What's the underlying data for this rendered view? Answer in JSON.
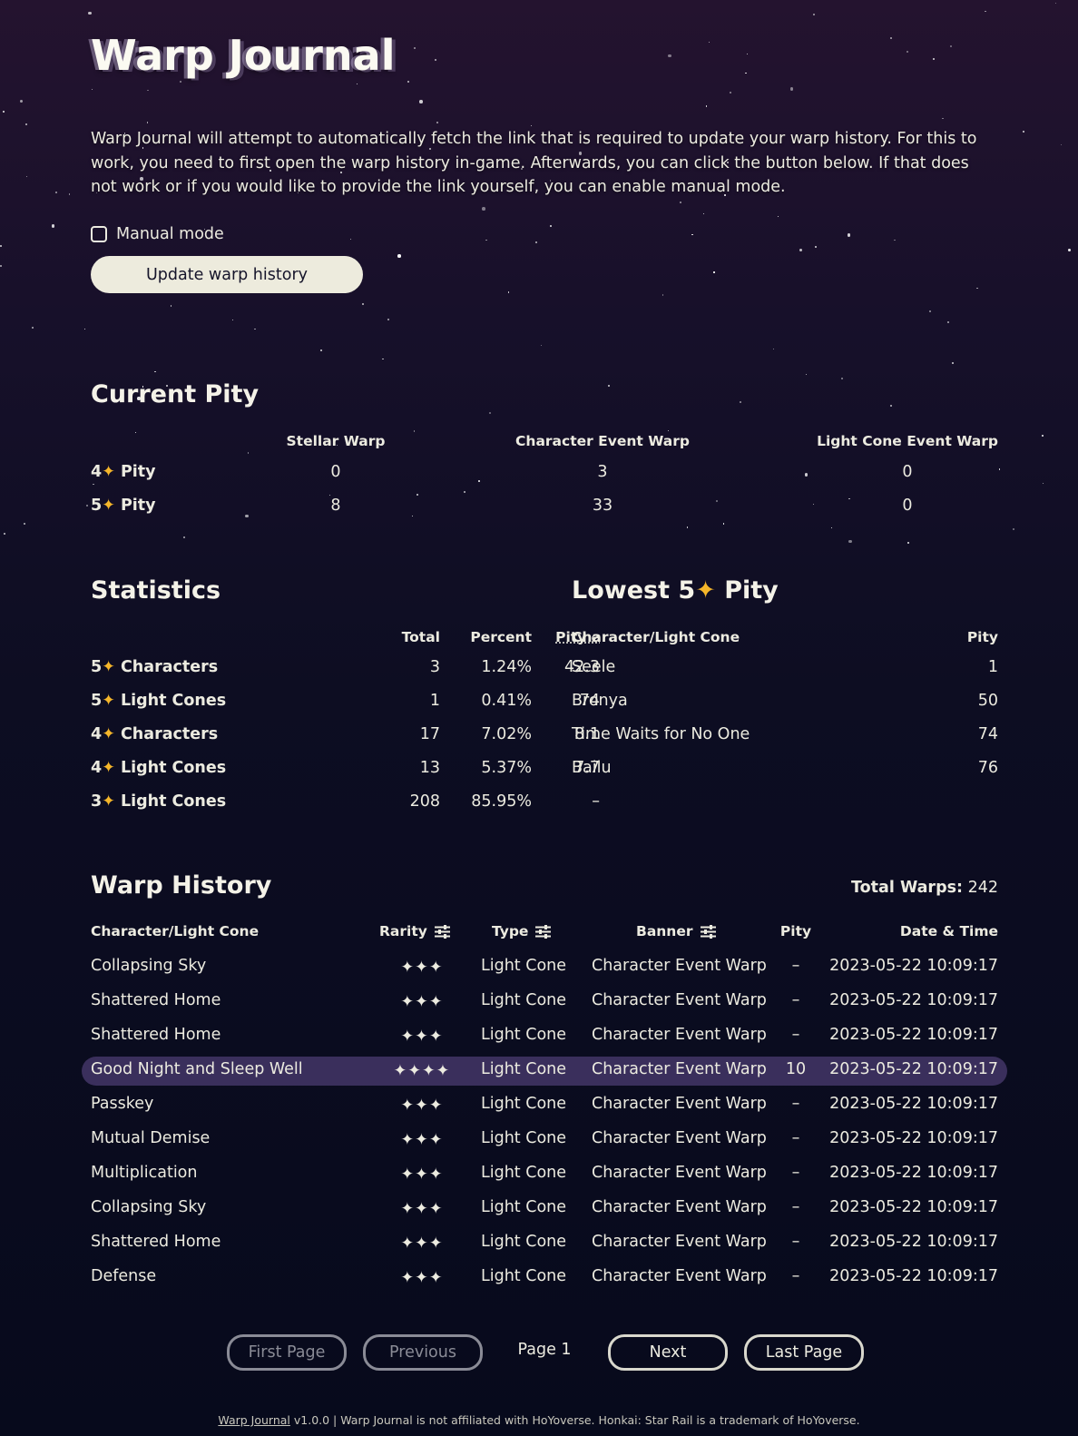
{
  "header": {
    "title": "Warp Journal",
    "intro": "Warp Journal will attempt to automatically fetch the link that is required to update your warp history. For this to work, you need to first open the warp history in-game. Afterwards, you can click the button below. If that does not work or if you would like to provide the link yourself, you can enable manual mode.",
    "manual_mode_label": "Manual mode",
    "manual_mode_checked": false,
    "update_button": "Update warp history"
  },
  "current_pity": {
    "heading": "Current Pity",
    "columns": [
      "Stellar Warp",
      "Character Event Warp",
      "Light Cone Event Warp"
    ],
    "rows": [
      {
        "num": "4",
        "label": "Pity",
        "values": [
          "0",
          "3",
          "0"
        ]
      },
      {
        "num": "5",
        "label": "Pity",
        "values": [
          "8",
          "33",
          "0"
        ]
      }
    ]
  },
  "statistics": {
    "heading": "Statistics",
    "columns": [
      "Total",
      "Percent",
      "Pity ⌀"
    ],
    "rows": [
      {
        "num": "5",
        "label": "Characters",
        "total": "3",
        "percent": "1.24%",
        "pity": "42.3"
      },
      {
        "num": "5",
        "label": "Light Cones",
        "total": "1",
        "percent": "0.41%",
        "pity": "74"
      },
      {
        "num": "4",
        "label": "Characters",
        "total": "17",
        "percent": "7.02%",
        "pity": "8.1"
      },
      {
        "num": "4",
        "label": "Light Cones",
        "total": "13",
        "percent": "5.37%",
        "pity": "7.7"
      },
      {
        "num": "3",
        "label": "Light Cones",
        "total": "208",
        "percent": "85.95%",
        "pity": "–"
      }
    ]
  },
  "lowest_pity": {
    "heading_prefix": "Lowest 5",
    "heading_suffix": "Pity",
    "columns": [
      "Character/Light Cone",
      "Pity"
    ],
    "rows": [
      {
        "name": "Seele",
        "pity": "1"
      },
      {
        "name": "Bronya",
        "pity": "50"
      },
      {
        "name": "Time Waits for No One",
        "pity": "74"
      },
      {
        "name": "Bailu",
        "pity": "76"
      }
    ]
  },
  "warp_history": {
    "heading": "Warp History",
    "total_label": "Total Warps:",
    "total_value": "242",
    "columns": {
      "name": "Character/Light Cone",
      "rarity": "Rarity",
      "type": "Type",
      "banner": "Banner",
      "pity": "Pity",
      "date": "Date & Time"
    },
    "rows": [
      {
        "name": "Collapsing Sky",
        "rarity": "✦✦✦",
        "type": "Light Cone",
        "banner": "Character Event Warp",
        "pity": "–",
        "date": "2023-05-22 10:09:17"
      },
      {
        "name": "Shattered Home",
        "rarity": "✦✦✦",
        "type": "Light Cone",
        "banner": "Character Event Warp",
        "pity": "–",
        "date": "2023-05-22 10:09:17"
      },
      {
        "name": "Shattered Home",
        "rarity": "✦✦✦",
        "type": "Light Cone",
        "banner": "Character Event Warp",
        "pity": "–",
        "date": "2023-05-22 10:09:17"
      },
      {
        "name": "Good Night and Sleep Well",
        "rarity": "✦✦✦✦",
        "type": "Light Cone",
        "banner": "Character Event Warp",
        "pity": "10",
        "date": "2023-05-22 10:09:17",
        "highlight": true
      },
      {
        "name": "Passkey",
        "rarity": "✦✦✦",
        "type": "Light Cone",
        "banner": "Character Event Warp",
        "pity": "–",
        "date": "2023-05-22 10:09:17"
      },
      {
        "name": "Mutual Demise",
        "rarity": "✦✦✦",
        "type": "Light Cone",
        "banner": "Character Event Warp",
        "pity": "–",
        "date": "2023-05-22 10:09:17"
      },
      {
        "name": "Multiplication",
        "rarity": "✦✦✦",
        "type": "Light Cone",
        "banner": "Character Event Warp",
        "pity": "–",
        "date": "2023-05-22 10:09:17"
      },
      {
        "name": "Collapsing Sky",
        "rarity": "✦✦✦",
        "type": "Light Cone",
        "banner": "Character Event Warp",
        "pity": "–",
        "date": "2023-05-22 10:09:17"
      },
      {
        "name": "Shattered Home",
        "rarity": "✦✦✦",
        "type": "Light Cone",
        "banner": "Character Event Warp",
        "pity": "–",
        "date": "2023-05-22 10:09:17"
      },
      {
        "name": "Defense",
        "rarity": "✦✦✦",
        "type": "Light Cone",
        "banner": "Character Event Warp",
        "pity": "–",
        "date": "2023-05-22 10:09:17"
      }
    ]
  },
  "pagination": {
    "first": "First Page",
    "previous": "Previous",
    "current": "Page 1",
    "next": "Next",
    "last": "Last Page"
  },
  "footer": {
    "link": "Warp Journal",
    "text": " v1.0.0 | Warp Journal is not affiliated with HoYoverse. Honkai: Star Rail is a trademark of HoYoverse."
  },
  "colors": {
    "accent_star": "#f5b62a",
    "highlight_row": "#3a2f5c",
    "button_bg": "#edebdd"
  }
}
